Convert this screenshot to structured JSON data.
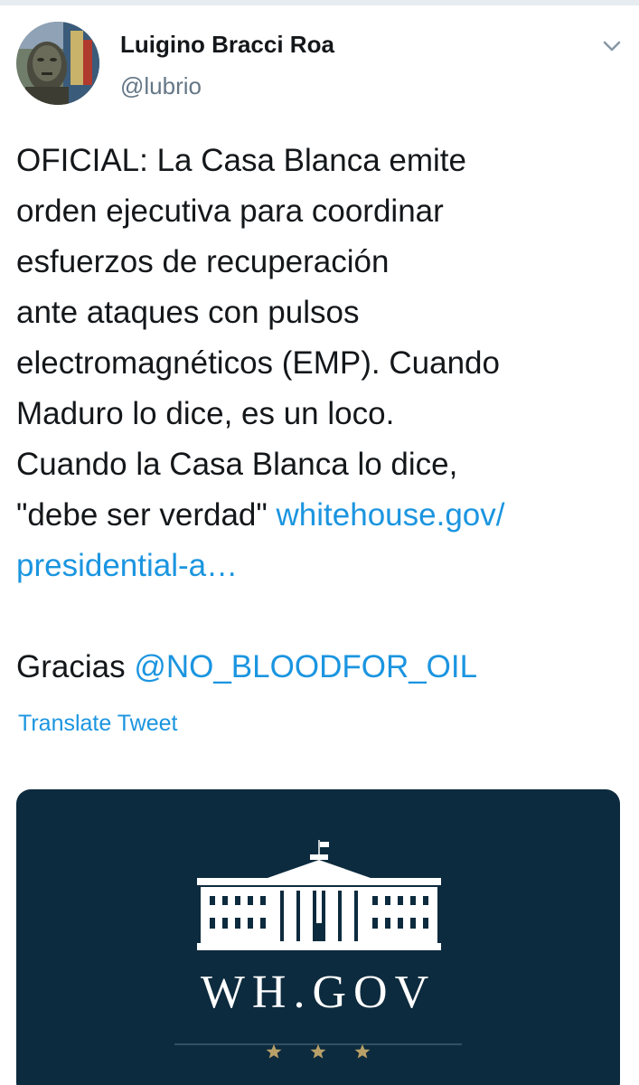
{
  "tweet": {
    "author": {
      "name": "Luigino Bracci Roa",
      "handle": "@lubrio"
    },
    "menu_icon": "chevron-down-icon",
    "text_lines": [
      [
        {
          "t": "OFICIAL: La Casa Blanca emite"
        }
      ],
      [
        {
          "t": "orden ejecutiva para coordinar"
        }
      ],
      [
        {
          "t": "esfuerzos de recuperación"
        }
      ],
      [
        {
          "t": "ante ataques con pulsos"
        }
      ],
      [
        {
          "t": "electromagnéticos (EMP). Cuando"
        }
      ],
      [
        {
          "t": "Maduro lo dice, es un loco."
        }
      ],
      [
        {
          "t": "Cuando la Casa Blanca lo dice,"
        }
      ],
      [
        {
          "t": "\"debe ser verdad\" "
        },
        {
          "t": "whitehouse.gov/",
          "link": true
        }
      ],
      [
        {
          "t": "presidential-a…",
          "link": true
        }
      ],
      [],
      [
        {
          "t": "Gracias "
        },
        {
          "t": "@NO_BLOODFOR_OIL",
          "link": true
        }
      ]
    ],
    "translate_label": "Translate Tweet",
    "card": {
      "wordmark": "WH.GOV",
      "logo_icon": "white-house-icon",
      "stars_icon": "three-stars-icon"
    }
  },
  "colors": {
    "text": "#14171a",
    "secondary": "#657786",
    "link": "#1b95e0",
    "card_bg": "#0d2b3e"
  }
}
